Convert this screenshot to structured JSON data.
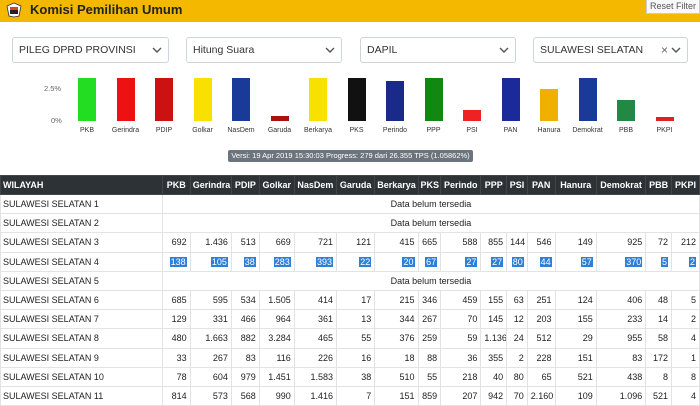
{
  "header": {
    "title": "Komisi Pemilihan Umum",
    "reset_label": "Reset Filter"
  },
  "filters": [
    {
      "value": "PILEG DPRD PROVINSI"
    },
    {
      "value": "Hitung Suara"
    },
    {
      "value": "DAPIL"
    },
    {
      "value": "SULAWESI SELATAN"
    }
  ],
  "chart_data": {
    "type": "bar",
    "categories": [
      "PKB",
      "Gerindra",
      "PDIP",
      "Golkar",
      "NasDem",
      "Garuda",
      "Berkarya",
      "PKS",
      "Perindo",
      "PPP",
      "PSI",
      "PAN",
      "Hanura",
      "Demokrat",
      "PBB",
      "PKPI"
    ],
    "colors": [
      "#22dd22",
      "#ee1111",
      "#cc1111",
      "#f8e000",
      "#1a3a9a",
      "#aa1111",
      "#f8e000",
      "#111111",
      "#1a2a88",
      "#118811",
      "#ee2222",
      "#1a2a99",
      "#f0b000",
      "#1a3a99",
      "#228844",
      "#dd2222"
    ],
    "values": [
      3.2,
      3.2,
      3.2,
      3.2,
      3.2,
      0.4,
      3.2,
      3.2,
      3.0,
      3.2,
      0.8,
      3.2,
      2.4,
      3.2,
      1.6,
      0.3
    ],
    "yticks": [
      "2.5%",
      "0%"
    ]
  },
  "version": "Versi: 19 Apr 2019 15:30:03 Progress: 279 dari 26.355 TPS (1.05862%)",
  "table": {
    "headers": [
      "WILAYAH",
      "PKB",
      "Gerindra",
      "PDIP",
      "Golkar",
      "NasDem",
      "Garuda",
      "Berkarya",
      "PKS",
      "Perindo",
      "PPP",
      "PSI",
      "PAN",
      "Hanura",
      "Demokrat",
      "PBB",
      "PKPI"
    ],
    "no_data": "Data belum tersedia",
    "rows": [
      {
        "name": "SULAWESI SELATAN 1",
        "values": null
      },
      {
        "name": "SULAWESI SELATAN 2",
        "values": null
      },
      {
        "name": "SULAWESI SELATAN 3",
        "values": [
          "692",
          "1.436",
          "513",
          "669",
          "721",
          "121",
          "415",
          "665",
          "588",
          "855",
          "144",
          "546",
          "149",
          "925",
          "72",
          "212"
        ]
      },
      {
        "name": "SULAWESI SELATAN 4",
        "values": [
          "138",
          "105",
          "38",
          "283",
          "393",
          "22",
          "20",
          "67",
          "27",
          "27",
          "80",
          "44",
          "57",
          "370",
          "5",
          "2"
        ],
        "highlight": true
      },
      {
        "name": "SULAWESI SELATAN 5",
        "values": null
      },
      {
        "name": "SULAWESI SELATAN 6",
        "values": [
          "685",
          "595",
          "534",
          "1.505",
          "414",
          "17",
          "215",
          "346",
          "459",
          "155",
          "63",
          "251",
          "124",
          "406",
          "48",
          "5"
        ]
      },
      {
        "name": "SULAWESI SELATAN 7",
        "values": [
          "129",
          "331",
          "466",
          "964",
          "361",
          "13",
          "344",
          "267",
          "70",
          "145",
          "12",
          "203",
          "155",
          "233",
          "14",
          "2"
        ]
      },
      {
        "name": "SULAWESI SELATAN 8",
        "values": [
          "480",
          "1.663",
          "882",
          "3.284",
          "465",
          "55",
          "376",
          "259",
          "59",
          "1.136",
          "24",
          "512",
          "29",
          "955",
          "58",
          "4"
        ]
      },
      {
        "name": "SULAWESI SELATAN 9",
        "values": [
          "33",
          "267",
          "83",
          "116",
          "226",
          "16",
          "18",
          "88",
          "36",
          "355",
          "2",
          "228",
          "151",
          "83",
          "172",
          "1"
        ]
      },
      {
        "name": "SULAWESI SELATAN 10",
        "values": [
          "78",
          "604",
          "979",
          "1.451",
          "1.583",
          "38",
          "510",
          "55",
          "218",
          "40",
          "80",
          "65",
          "521",
          "438",
          "8",
          "8"
        ]
      },
      {
        "name": "SULAWESI SELATAN 11",
        "values": [
          "814",
          "573",
          "568",
          "990",
          "1.416",
          "7",
          "151",
          "859",
          "207",
          "942",
          "70",
          "2.160",
          "109",
          "1.096",
          "521",
          "4"
        ]
      }
    ]
  }
}
